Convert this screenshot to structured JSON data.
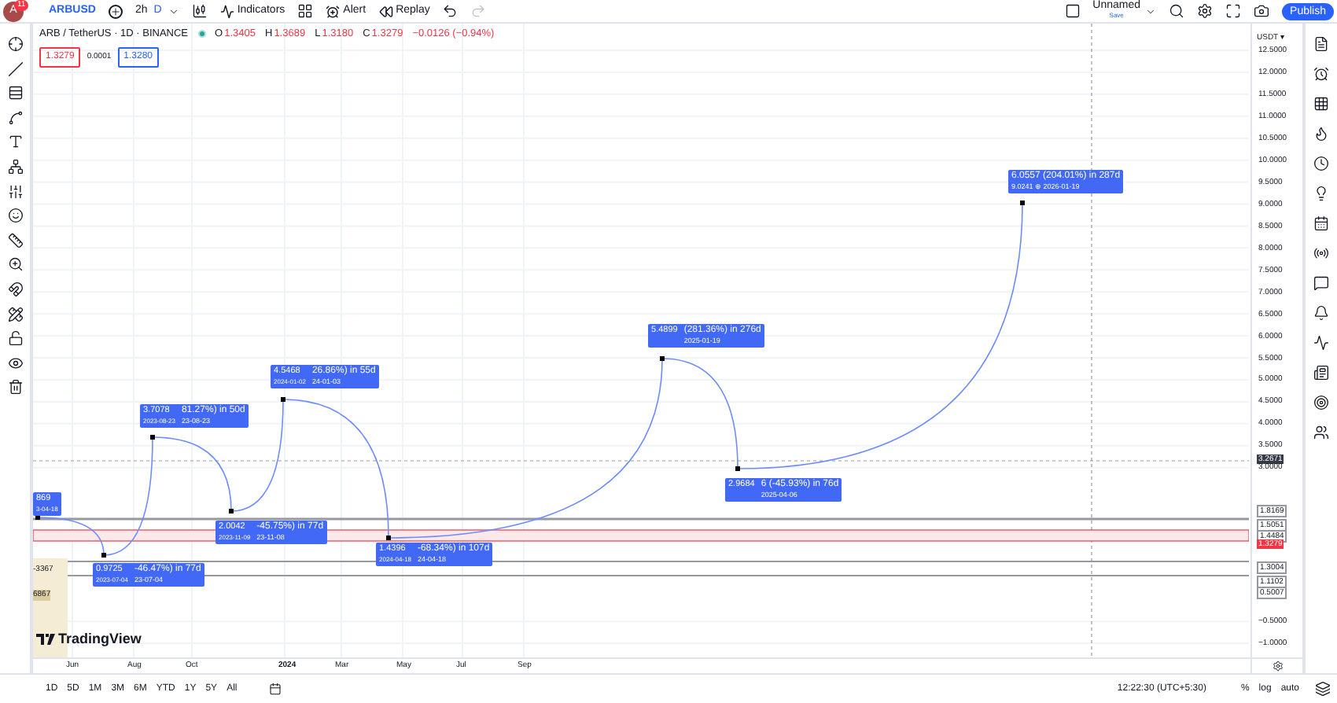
{
  "top_bar": {
    "avatar": {
      "letter": "A",
      "badge": "11"
    },
    "symbol": "ARBUSD",
    "interval": "2h",
    "interval_unit": "D",
    "buttons": [
      "Indicators",
      "Alert",
      "Replay"
    ],
    "layout": {
      "name": "Unnamed",
      "status": "Save"
    },
    "publish": "Publish"
  },
  "legend": {
    "title": "ARB / TetherUS · 1D · BINANCE",
    "ohlc": [
      {
        "label": "O",
        "value": "1.3405"
      },
      {
        "label": "H",
        "value": "1.3689"
      },
      {
        "label": "L",
        "value": "1.3180"
      },
      {
        "label": "C",
        "value": "1.3279"
      }
    ],
    "change": "−0.0126 (−0.94%)",
    "bid": "1.3279",
    "spread": "0.0001",
    "ask": "1.3280"
  },
  "measurements": [
    {
      "price": "869",
      "date": "3-04-18"
    },
    {
      "price": "0.9725",
      "date": "2023-07-04",
      "change": "-46.47%) in 77d",
      "change_date": "23-07-04"
    },
    {
      "price": "3.7078",
      "date": "2023-08-23",
      "change": "81.27%) in 50d",
      "change_date": "23-08-23"
    },
    {
      "price": "2.0042",
      "date": "2023-11-09",
      "change": "-45.75%) in 77d",
      "change_date": "23-11-08"
    },
    {
      "price": "4.5468",
      "date": "2024-01-02",
      "change": "26.86%) in 55d",
      "change_date": "24-01-03"
    },
    {
      "price": "1.4396",
      "date": "2024-04-18",
      "change": "-68.34%) in 107d",
      "change_date": "24-04-18"
    },
    {
      "price": "5.4899",
      "change": "(281.36%) in 276d",
      "change_date": "2025-01-19"
    },
    {
      "price": "2.9684",
      "change": "6 (-45.93%) in 76d",
      "change_date": "2025-04-06"
    },
    {
      "change": "6.0557 (204.01%) in 287d",
      "change_date": "9.0241 ⊕ 2026-01-19"
    }
  ],
  "position_tool": {
    "stop": "-3367",
    "target": "6867"
  },
  "price_axis": {
    "currency": "USDT ▾",
    "labels": [
      {
        "value": "12.5000",
        "kind": "tick"
      },
      {
        "value": "12.0000",
        "kind": "tick"
      },
      {
        "value": "11.5000",
        "kind": "tick"
      },
      {
        "value": "11.0000",
        "kind": "tick"
      },
      {
        "value": "10.5000",
        "kind": "tick"
      },
      {
        "value": "10.0000",
        "kind": "tick"
      },
      {
        "value": "9.5000",
        "kind": "tick"
      },
      {
        "value": "9.0000",
        "kind": "tick"
      },
      {
        "value": "8.5000",
        "kind": "tick"
      },
      {
        "value": "8.0000",
        "kind": "tick"
      },
      {
        "value": "7.5000",
        "kind": "tick"
      },
      {
        "value": "7.0000",
        "kind": "tick"
      },
      {
        "value": "6.5000",
        "kind": "tick"
      },
      {
        "value": "6.0000",
        "kind": "tick"
      },
      {
        "value": "5.5000",
        "kind": "tick"
      },
      {
        "value": "5.0000",
        "kind": "tick"
      },
      {
        "value": "4.5000",
        "kind": "tick"
      },
      {
        "value": "4.0000",
        "kind": "tick"
      },
      {
        "value": "3.5000",
        "kind": "tick"
      },
      {
        "value": "3.2671",
        "kind": "crosshair"
      },
      {
        "value": "3.0000",
        "kind": "tick"
      },
      {
        "value": "1.8169",
        "kind": "line"
      },
      {
        "value": "1.5051",
        "kind": "line"
      },
      {
        "value": "1.4484",
        "kind": "line"
      },
      {
        "value": "1.3279",
        "kind": "last"
      },
      {
        "value": "1.3004",
        "kind": "line"
      },
      {
        "value": "1.1102",
        "kind": "line"
      },
      {
        "value": "0.5007",
        "kind": "line"
      },
      {
        "value": "−0.5000",
        "kind": "tick"
      },
      {
        "value": "−1.0000",
        "kind": "tick"
      }
    ]
  },
  "time_axis": [
    {
      "label": "Jun",
      "kind": "month"
    },
    {
      "label": "Aug",
      "kind": "month"
    },
    {
      "label": "Oct",
      "kind": "month"
    },
    {
      "label": "2024",
      "kind": "year"
    },
    {
      "label": "Mar",
      "kind": "month"
    },
    {
      "label": "May",
      "kind": "month"
    },
    {
      "label": "Jul",
      "kind": "month"
    },
    {
      "label": "Sep",
      "kind": "month"
    }
  ],
  "watermark_logo": "TradingView",
  "bottom_bar": {
    "ranges": [
      "1D",
      "5D",
      "1M",
      "3M",
      "6M",
      "YTD",
      "1Y",
      "5Y",
      "All"
    ],
    "time": "12:22:30 (UTC+5:30)",
    "scales": [
      "%",
      "log",
      "auto"
    ]
  }
}
